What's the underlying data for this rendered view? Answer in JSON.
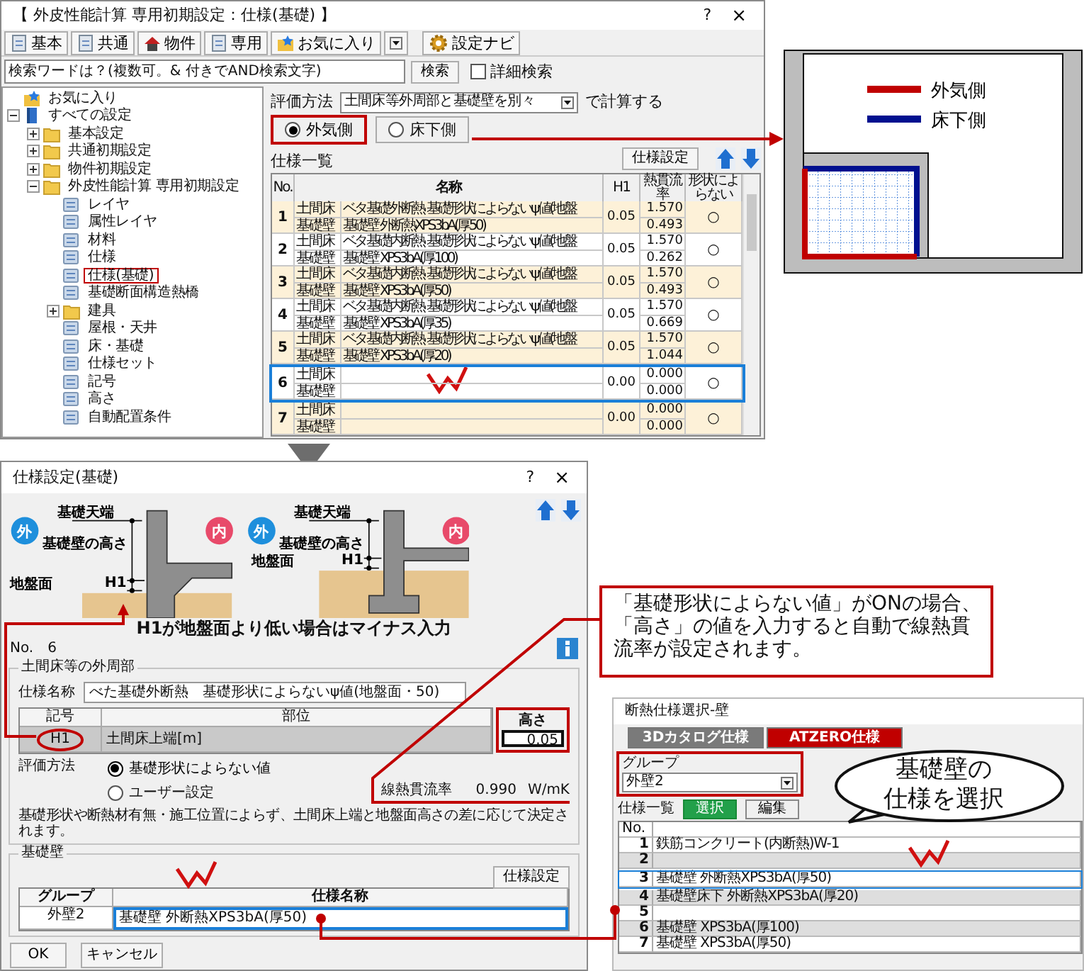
{
  "main_window": {
    "title": "【 外皮性能計算 専用初期設定：仕様(基礎) 】",
    "help": "?",
    "close": "×",
    "toolbar": [
      {
        "label": "基本",
        "kind": "doc"
      },
      {
        "label": "共通",
        "kind": "doc"
      },
      {
        "label": "物件",
        "kind": "house"
      },
      {
        "label": "専用",
        "kind": "doc"
      },
      {
        "label": "お気に入り",
        "kind": "star"
      }
    ],
    "navi_button": "設定ナビ",
    "search": {
      "placeholder": "検索ワードは？(複数可。& 付きでAND検索文字)",
      "button": "検索"
    },
    "detail_search": {
      "label": "詳細検索",
      "checked": false
    },
    "tree": [
      {
        "label": "お気に入り",
        "kind": "favorite",
        "selected": false
      },
      {
        "label": "すべての設定",
        "kind": "root",
        "expanded": true,
        "selected": false,
        "children": [
          {
            "label": "基本設定",
            "kind": "folder",
            "expanded": false,
            "selected": false
          },
          {
            "label": "共通初期設定",
            "kind": "folder",
            "expanded": false,
            "selected": false
          },
          {
            "label": "物件初期設定",
            "kind": "folder",
            "expanded": false,
            "selected": false
          },
          {
            "label": "外皮性能計算 専用初期設定",
            "kind": "folder",
            "expanded": true,
            "selected": false,
            "children": [
              {
                "label": "レイヤ",
                "kind": "item",
                "selected": false
              },
              {
                "label": "属性レイヤ",
                "kind": "item",
                "selected": false
              },
              {
                "label": "材料",
                "kind": "item",
                "selected": false
              },
              {
                "label": "仕様",
                "kind": "item",
                "selected": false
              },
              {
                "label": "仕様(基礎)",
                "kind": "item",
                "selected": true
              },
              {
                "label": "基礎断面構造熱橋",
                "kind": "item",
                "selected": false
              },
              {
                "label": "建具",
                "kind": "folder",
                "expanded": false,
                "selected": false
              },
              {
                "label": "屋根・天井",
                "kind": "item",
                "selected": false
              },
              {
                "label": "床・基礎",
                "kind": "item",
                "selected": false
              },
              {
                "label": "仕様セット",
                "kind": "item",
                "selected": false
              },
              {
                "label": "記号",
                "kind": "item",
                "selected": false
              },
              {
                "label": "高さ",
                "kind": "item",
                "selected": false
              },
              {
                "label": "自動配置条件",
                "kind": "item",
                "selected": false
              }
            ]
          }
        ]
      }
    ],
    "evaluation": {
      "label": "評価方法",
      "value": "土間床等外周部と基礎壁を別々",
      "suffix": "で計算する"
    },
    "sides": [
      {
        "label": "外気側",
        "selected": true
      },
      {
        "label": "床下側",
        "selected": false
      }
    ],
    "spec_list": {
      "title": "仕様一覧",
      "settings_button": "仕様設定",
      "columns": [
        "No.",
        "名称",
        "H1",
        "熱貫流率",
        "形状によらない"
      ],
      "rows": [
        {
          "no": "1",
          "parts": [
            "土間床",
            "基礎壁"
          ],
          "names": [
            "ベタ基礎外断熱 基礎形状によらないψ値(地盤",
            "基礎壁 外断熱XPS3bA(厚50)"
          ],
          "h1": "0.05",
          "values": [
            "1.570",
            "0.493"
          ],
          "mark": "○",
          "selected": false
        },
        {
          "no": "2",
          "parts": [
            "土間床",
            "基礎壁"
          ],
          "names": [
            "ベタ基礎内断熱 基礎形状によらないψ値(地盤",
            "基礎壁 XPS3bA(厚100)"
          ],
          "h1": "0.05",
          "values": [
            "1.570",
            "0.262"
          ],
          "mark": "○",
          "selected": false
        },
        {
          "no": "3",
          "parts": [
            "土間床",
            "基礎壁"
          ],
          "names": [
            "ベタ基礎内断熱 基礎形状によらないψ値(地盤",
            "基礎壁 XPS3bA(厚50)"
          ],
          "h1": "0.05",
          "values": [
            "1.570",
            "0.493"
          ],
          "mark": "○",
          "selected": false
        },
        {
          "no": "4",
          "parts": [
            "土間床",
            "基礎壁"
          ],
          "names": [
            "ベタ基礎内断熱 基礎形状によらないψ値(地盤",
            "基礎壁 XPS3bA(厚35)"
          ],
          "h1": "0.05",
          "values": [
            "1.570",
            "0.669"
          ],
          "mark": "○",
          "selected": false
        },
        {
          "no": "5",
          "parts": [
            "土間床",
            "基礎壁"
          ],
          "names": [
            "ベタ基礎内断熱 基礎形状によらないψ値(地盤",
            "基礎壁 XPS3bA(厚20)"
          ],
          "h1": "0.05",
          "values": [
            "1.570",
            "1.044"
          ],
          "mark": "○",
          "selected": false
        },
        {
          "no": "6",
          "parts": [
            "土間床",
            "基礎壁"
          ],
          "h1": "0.00",
          "values": [
            "0.000",
            "0.000"
          ],
          "mark": "○",
          "selected": true
        },
        {
          "no": "7",
          "parts": [
            "土間床",
            "基礎壁"
          ],
          "h1": "0.00",
          "values": [
            "0.000",
            "0.000"
          ],
          "mark": "○",
          "selected": false
        }
      ]
    }
  },
  "legend": {
    "items": [
      {
        "label": "外気側",
        "color": "#c00000"
      },
      {
        "label": "床下側",
        "color": "#00108f"
      }
    ]
  },
  "settings_dialog": {
    "title": "仕様設定(基礎)",
    "help": "?",
    "close": "×",
    "figure": {
      "panels": [
        {
          "outside": "外",
          "inside": "内",
          "top_label": "基礎天端",
          "height_label": "基礎壁の高さ",
          "ground_label": "地盤面",
          "h1_label": "H1"
        },
        {
          "outside": "外",
          "inside": "内",
          "top_label": "基礎天端",
          "height_label": "基礎壁の高さ",
          "ground_label": "地盤面",
          "h1_label": "H1"
        }
      ],
      "caption": "H1が地盤面より低い場合はマイナス入力"
    },
    "number": "No.　6",
    "perimeter": {
      "title": "土間床等の外周部",
      "name_label": "仕様名称",
      "name_value": "べた基礎外断熱　基礎形状によらないψ値(地盤面・50)",
      "columns": [
        "記号",
        "部位",
        "高さ"
      ],
      "row": [
        "H1",
        "土間床上端[m]",
        "0.05"
      ],
      "method_label": "評価方法",
      "methods": [
        {
          "label": "基礎形状によらない値",
          "selected": true
        },
        {
          "label": "ユーザー設定",
          "selected": false
        }
      ],
      "psi_label": "線熱貫流率",
      "psi_value": "0.990",
      "psi_unit": "W/mK",
      "note": "基礎形状や断熱材有無・施工位置によらず、土間床上端と地盤面高さの差に応じて決定されます。"
    },
    "wall": {
      "title": "基礎壁",
      "settings_button": "仕様設定",
      "columns": [
        "グループ",
        "仕様名称"
      ],
      "rows": [
        {
          "group": "外壁2",
          "name": "基礎壁 外断熱XPS3bA(厚50)",
          "selected": true
        }
      ]
    },
    "buttons": [
      "OK",
      "キャンセル"
    ]
  },
  "callout": "「基礎形状によらない値」がONの場合、「高さ」の値を入力すると自動で線熱貫流率が設定されます。",
  "picker": {
    "title": "断熱仕様選択-壁",
    "tabs": [
      {
        "label": "3Dカタログ仕様",
        "selected": false
      },
      {
        "label": "ATZERO仕様",
        "selected": true
      }
    ],
    "group_label": "グループ",
    "group_value": "外壁2",
    "list_title": "仕様一覧",
    "buttons": [
      {
        "label": "選択",
        "kind": "primary"
      },
      {
        "label": "編集",
        "kind": "plain"
      }
    ],
    "columns": [
      "No."
    ],
    "rows": [
      {
        "no": "1",
        "name": "鉄筋コンクリート(内断熱)W-1",
        "selected": false
      },
      {
        "no": "2",
        "selected": false
      },
      {
        "no": "3",
        "name": "基礎壁 外断熱XPS3bA(厚50)",
        "selected": true
      },
      {
        "no": "4",
        "name": "基礎壁床下 外断熱XPS3bA(厚20)",
        "selected": false
      },
      {
        "no": "5",
        "selected": false
      },
      {
        "no": "6",
        "name": "基礎壁 XPS3bA(厚100)",
        "selected": false
      },
      {
        "no": "7",
        "name": "基礎壁 XPS3bA(厚50)",
        "selected": false
      }
    ]
  },
  "bubble": [
    "基礎壁の",
    "仕様を選択"
  ]
}
